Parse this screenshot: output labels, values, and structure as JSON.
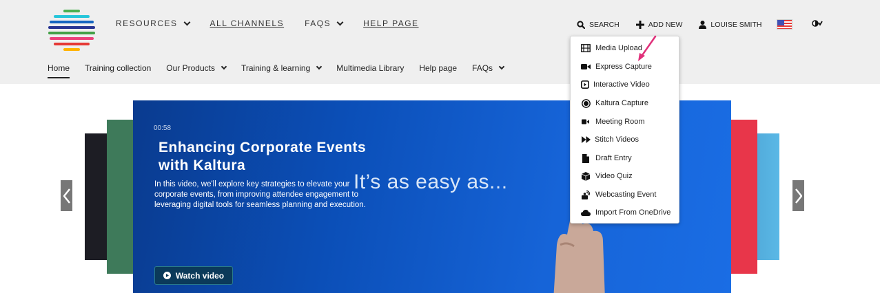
{
  "colors": {
    "header_bg": "#efefef",
    "hero_blue": "#0b4fb8",
    "watch_button": "#0b3a5a",
    "pointer_arrow": "#e0307a"
  },
  "logo": {
    "stripe_colors": [
      "#4caf50",
      "#26c6da",
      "#1565c0",
      "#283593",
      "#43a047",
      "#ec407a",
      "#e53935",
      "#ffb300"
    ]
  },
  "top_nav": {
    "items": [
      {
        "label": "RESOURCES",
        "dropdown": true
      },
      {
        "label": "ALL CHANNELS",
        "dropdown": false
      },
      {
        "label": "FAQS",
        "dropdown": true
      },
      {
        "label": "HELP PAGE",
        "dropdown": false
      }
    ]
  },
  "sub_nav": {
    "items": [
      {
        "label": "Home",
        "active": true
      },
      {
        "label": "Training collection"
      },
      {
        "label": "Our Products",
        "dropdown": true
      },
      {
        "label": "Training & learning",
        "dropdown": true
      },
      {
        "label": "Multimedia Library"
      },
      {
        "label": "Help page"
      },
      {
        "label": "FAQs",
        "dropdown": true
      }
    ]
  },
  "header_right": {
    "search": "SEARCH",
    "add_new": "ADD NEW",
    "user": "LOUISE SMITH",
    "language_flag": "us-flag-icon",
    "contrast": "contrast-toggle-icon"
  },
  "add_new_menu": {
    "items": [
      {
        "label": "Media Upload",
        "icon": "film-icon"
      },
      {
        "label": "Express Capture",
        "icon": "video-camera-icon"
      },
      {
        "label": "Interactive Video",
        "icon": "play-square-icon"
      },
      {
        "label": "Kaltura Capture",
        "icon": "record-icon"
      },
      {
        "label": "Meeting Room",
        "icon": "video-call-icon"
      },
      {
        "label": "Stitch Videos",
        "icon": "fast-forward-icon"
      },
      {
        "label": "Draft Entry",
        "icon": "file-icon"
      },
      {
        "label": "Video Quiz",
        "icon": "cube-icon"
      },
      {
        "label": "Webcasting Event",
        "icon": "broadcast-icon"
      },
      {
        "label": "Import From OneDrive",
        "icon": "cloud-icon"
      }
    ]
  },
  "hero": {
    "duration": "00:58",
    "title": "Enhancing Corporate Events with Kaltura",
    "description": "In this video, we'll explore key strategies to elevate your corporate events, from improving attendee engagement to leveraging digital tools for seamless planning and execution.",
    "overlay_text": "It’s as easy as...",
    "watch_button": "Watch video"
  }
}
